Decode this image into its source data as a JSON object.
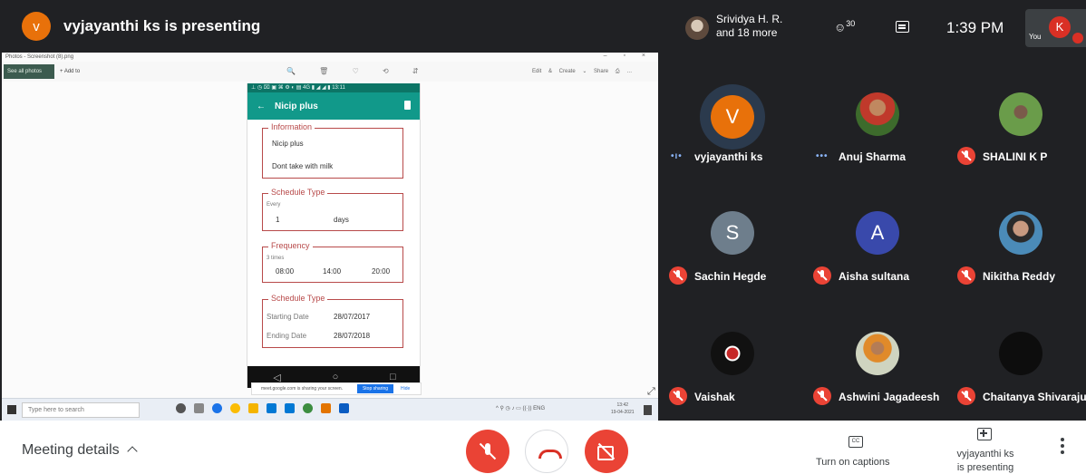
{
  "presenting": {
    "avatar_letter": "v",
    "title": "vyjayanthi ks is presenting"
  },
  "shared_screen": {
    "window_title": "Photos - Screenshot (8).png",
    "window_controls": "– ▫ ×",
    "toolbar": {
      "see_all_photos": "See all photos",
      "add_to": "+ Add to",
      "icons": "🔍 🗑 ♡ ⟲ ⇵",
      "right": "Edit & Create ⌄ Share ⎙ …"
    },
    "phone": {
      "status_bar": "⊥ ◷ ⌧ ▣ ⌘ ⚙ ◐ ▤ 4G ▮ ◢ ◢ ▮ 13:11",
      "appbar_title": "Nicip plus",
      "back_glyph": "←",
      "information": {
        "legend": "Information",
        "name": "Nicip plus",
        "note": "Dont take with milk"
      },
      "schedule_type_1": {
        "legend": "Schedule Type",
        "caption": "Every",
        "value": "1",
        "unit": "days"
      },
      "frequency": {
        "legend": "Frequency",
        "caption": "3 times",
        "times": [
          "08:00",
          "14:00",
          "20:00"
        ]
      },
      "schedule_type_2": {
        "legend": "Schedule Type",
        "starting_label": "Starting Date",
        "starting_value": "28/07/2017",
        "ending_label": "Ending Date",
        "ending_value": "28/07/2018"
      },
      "nav": [
        "◁",
        "○",
        "□"
      ]
    },
    "share_bar": {
      "text": "meet.google.com is sharing your screen.",
      "stop_label": "Stop sharing",
      "hide_label": "Hide"
    },
    "expand_glyph": "⤢",
    "taskbar": {
      "search_placeholder": "Type here to search",
      "tray": "^ ⚲ ◷ ♪ ▭ ((·)) ENG",
      "time": "13:42",
      "date": "19-04-2021"
    }
  },
  "header_right": {
    "pinned_name_line1": "Srividya H. R.",
    "pinned_name_line2": "and 18 more",
    "people_icon": "people-icon",
    "people_count": "30",
    "chat_icon": "chat-icon",
    "clock": "1:39 PM",
    "self_label": "You",
    "self_letter": "K"
  },
  "participants": [
    {
      "name": "vyjayanthi ks",
      "letter": "V",
      "color": "#e8710a",
      "status": "talking"
    },
    {
      "name": "Anuj Sharma",
      "photo": true,
      "status": "ellipsis"
    },
    {
      "name": "SHALINI K P",
      "photo": true,
      "status": "muted"
    },
    {
      "name": "Sachin Hegde",
      "letter": "S",
      "color": "#6e7e8c",
      "status": "muted"
    },
    {
      "name": "Aisha sultana",
      "letter": "A",
      "color": "#3949ab",
      "status": "muted"
    },
    {
      "name": "Nikitha Reddy",
      "photo": true,
      "status": "muted"
    },
    {
      "name": "Vaishak",
      "photo": true,
      "status": "muted"
    },
    {
      "name": "Ashwini Jagadeesh",
      "photo": true,
      "status": "muted"
    },
    {
      "name": "Chaitanya Shivaraju",
      "photo": true,
      "status": "muted"
    }
  ],
  "participant_indicators": {
    "talking_glyph": "•ı•",
    "ellipsis_glyph": "•••"
  },
  "bottom_bar": {
    "meeting_details": "Meeting details",
    "captions_icon_text": "CC",
    "captions_label": "Turn on captions",
    "presenting_label_line1": "vyjayanthi ks",
    "presenting_label_line2": "is presenting"
  },
  "colors": {
    "background": "#202124",
    "end_call_red": "#d93025",
    "muted_red": "#ea4335",
    "phone_teal": "#11998a",
    "card_border": "#b84a4a"
  }
}
